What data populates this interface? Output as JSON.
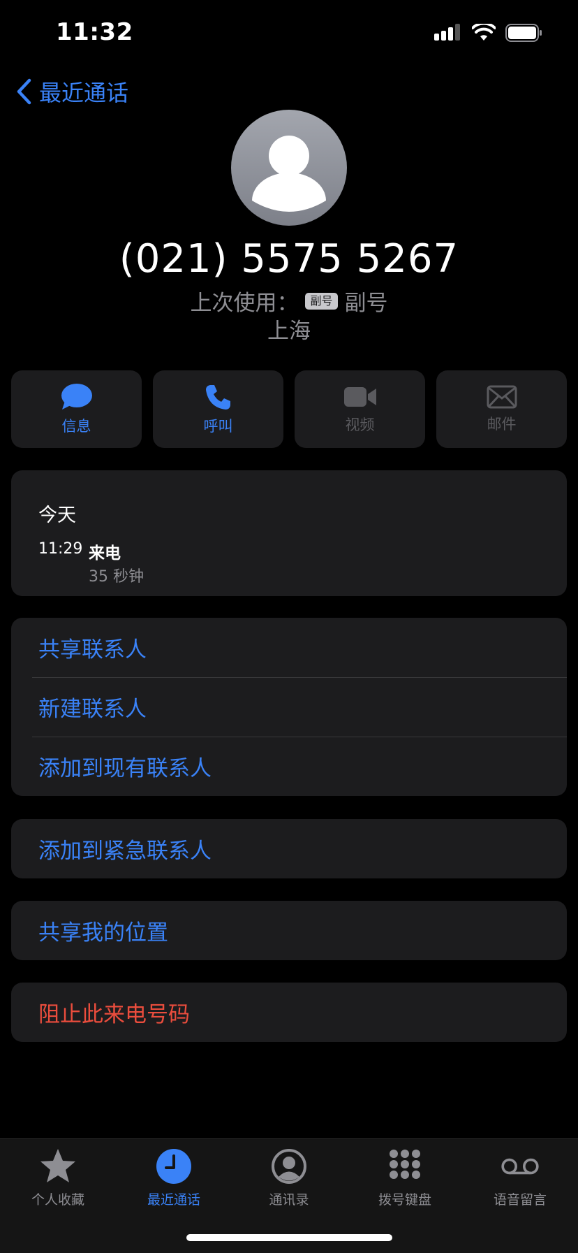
{
  "status_bar": {
    "time": "11:32"
  },
  "nav": {
    "back_label": "最近通话"
  },
  "contact": {
    "phone_number": "(021) 5575 5267",
    "last_used_label": "上次使用：",
    "sim_badge": "副号",
    "sim_name": "副号",
    "location": "上海"
  },
  "actions": [
    {
      "label": "信息",
      "icon": "message-bubble-icon",
      "enabled": true
    },
    {
      "label": "呼叫",
      "icon": "phone-icon",
      "enabled": true
    },
    {
      "label": "视频",
      "icon": "video-camera-icon",
      "enabled": false
    },
    {
      "label": "邮件",
      "icon": "envelope-icon",
      "enabled": false
    }
  ],
  "history": {
    "date": "今天",
    "time": "11:29",
    "type": "来电",
    "duration": "35 秒钟"
  },
  "contact_options": [
    "共享联系人",
    "新建联系人",
    "添加到现有联系人"
  ],
  "emergency_option": "添加到紧急联系人",
  "share_location_option": "共享我的位置",
  "block_option": "阻止此来电号码",
  "tabs": [
    {
      "label": "个人收藏",
      "icon": "star-icon",
      "active": false
    },
    {
      "label": "最近通话",
      "icon": "clock-icon",
      "active": true
    },
    {
      "label": "通讯录",
      "icon": "person-circle-icon",
      "active": false
    },
    {
      "label": "拨号键盘",
      "icon": "keypad-icon",
      "active": false
    },
    {
      "label": "语音留言",
      "icon": "voicemail-icon",
      "active": false
    }
  ],
  "colors": {
    "accent": "#3a82f7",
    "destructive": "#eb4d3d",
    "card": "#1c1c1e",
    "secondary_text": "#8e8e93"
  }
}
